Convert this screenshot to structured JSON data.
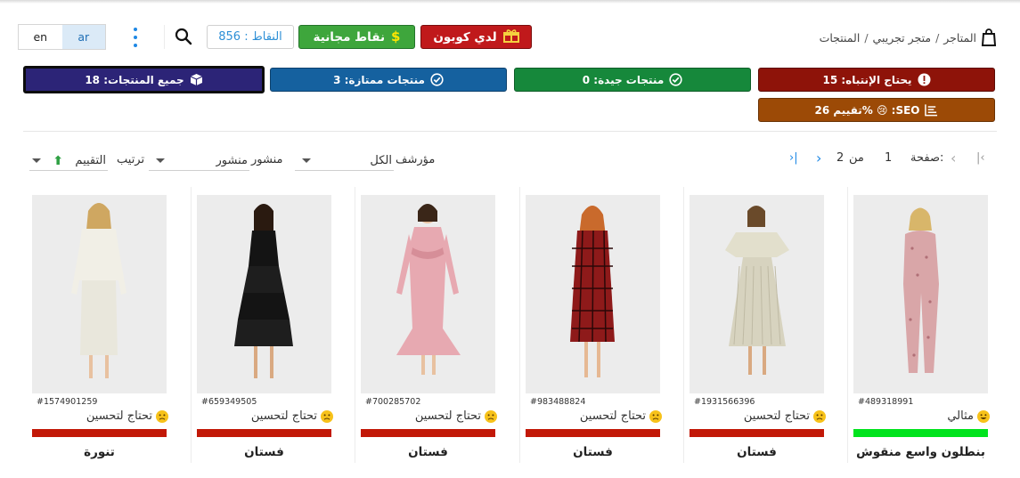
{
  "breadcrumb": {
    "root": "المتاجر",
    "store": "متجر تجريبي",
    "current": "المنتجات",
    "sep": "/"
  },
  "header": {
    "coupon_label": "لدي كوبون",
    "free_points_label": "نقاط مجانية",
    "points_text": "النقاط : 856",
    "lang_en": "en",
    "lang_ar": "ar"
  },
  "cards": {
    "attention": "يحتاج الإنتباه: 15",
    "good": "منتجات جيدة: 0",
    "excellent": "منتجات ممتازة: 3",
    "all": "جميع المنتجات: 18",
    "seo": "تقييم 26% 😢 :SEO"
  },
  "pagination": {
    "label": "صفحة:",
    "current": "1",
    "of": "من",
    "total": "2"
  },
  "filters": {
    "archived_label": "مؤرشف",
    "archived_value": "الكل",
    "published_label": "منشور",
    "published_value": "منشور",
    "sort_label": "ترتيب",
    "sort_value": "التقييم"
  },
  "colors": {
    "attention": "#8e1309",
    "good": "#16883b",
    "excellent": "#15619f",
    "all": "#2c2477",
    "seo": "#9c4a06",
    "bar_bad": "#c21807",
    "bar_good": "#00e31d"
  },
  "products": [
    {
      "sku": "#489318991",
      "status": "مثالي",
      "mood": "happy",
      "score": 1.0,
      "name": "بنطلون واسع منقوش"
    },
    {
      "sku": "#1931566396",
      "status": "تحتاج لتحسين",
      "mood": "sad",
      "score": 1.0,
      "name": "فستان"
    },
    {
      "sku": "#983488824",
      "status": "تحتاج لتحسين",
      "mood": "sad",
      "score": 1.0,
      "name": "فستان"
    },
    {
      "sku": "#700285702",
      "status": "تحتاج لتحسين",
      "mood": "sad",
      "score": 1.0,
      "name": "فستان"
    },
    {
      "sku": "#659349505",
      "status": "تحتاج لتحسين",
      "mood": "sad",
      "score": 1.0,
      "name": "فستان"
    },
    {
      "sku": "#1574901259",
      "status": "تحتاج لتحسين",
      "mood": "sad",
      "score": 1.0,
      "name": "تنورة"
    }
  ]
}
